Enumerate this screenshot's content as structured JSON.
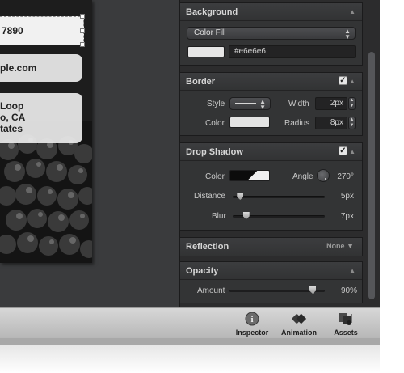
{
  "canvas": {
    "phone_partial": "7890",
    "email_partial": "ple.com",
    "address_lines": [
      "Loop",
      "o, CA",
      "tates"
    ]
  },
  "inspector": {
    "background": {
      "title": "Background",
      "fill_type": "Color Fill",
      "color_hex": "#e6e6e6",
      "swatch_color": "#e6e6e6"
    },
    "border": {
      "title": "Border",
      "enabled": true,
      "style_label": "Style",
      "width_label": "Width",
      "width_value": "2px",
      "color_label": "Color",
      "color_swatch": "#e3e3e3",
      "radius_label": "Radius",
      "radius_value": "8px"
    },
    "drop_shadow": {
      "title": "Drop Shadow",
      "enabled": true,
      "color_label": "Color",
      "angle_label": "Angle",
      "angle_value": "270°",
      "distance_label": "Distance",
      "distance_value": "5px",
      "distance_fraction": 0.05,
      "blur_label": "Blur",
      "blur_value": "7px",
      "blur_fraction": 0.12
    },
    "reflection": {
      "title": "Reflection",
      "value": "None"
    },
    "opacity": {
      "title": "Opacity",
      "amount_label": "Amount",
      "amount_value": "90%",
      "amount_fraction": 0.9
    }
  },
  "toolbar": {
    "inspector_label": "Inspector",
    "animation_label": "Animation",
    "assets_label": "Assets"
  },
  "icons": {
    "collapse": "▲",
    "expand": "▼",
    "popup": "⇕",
    "check": "✓"
  }
}
